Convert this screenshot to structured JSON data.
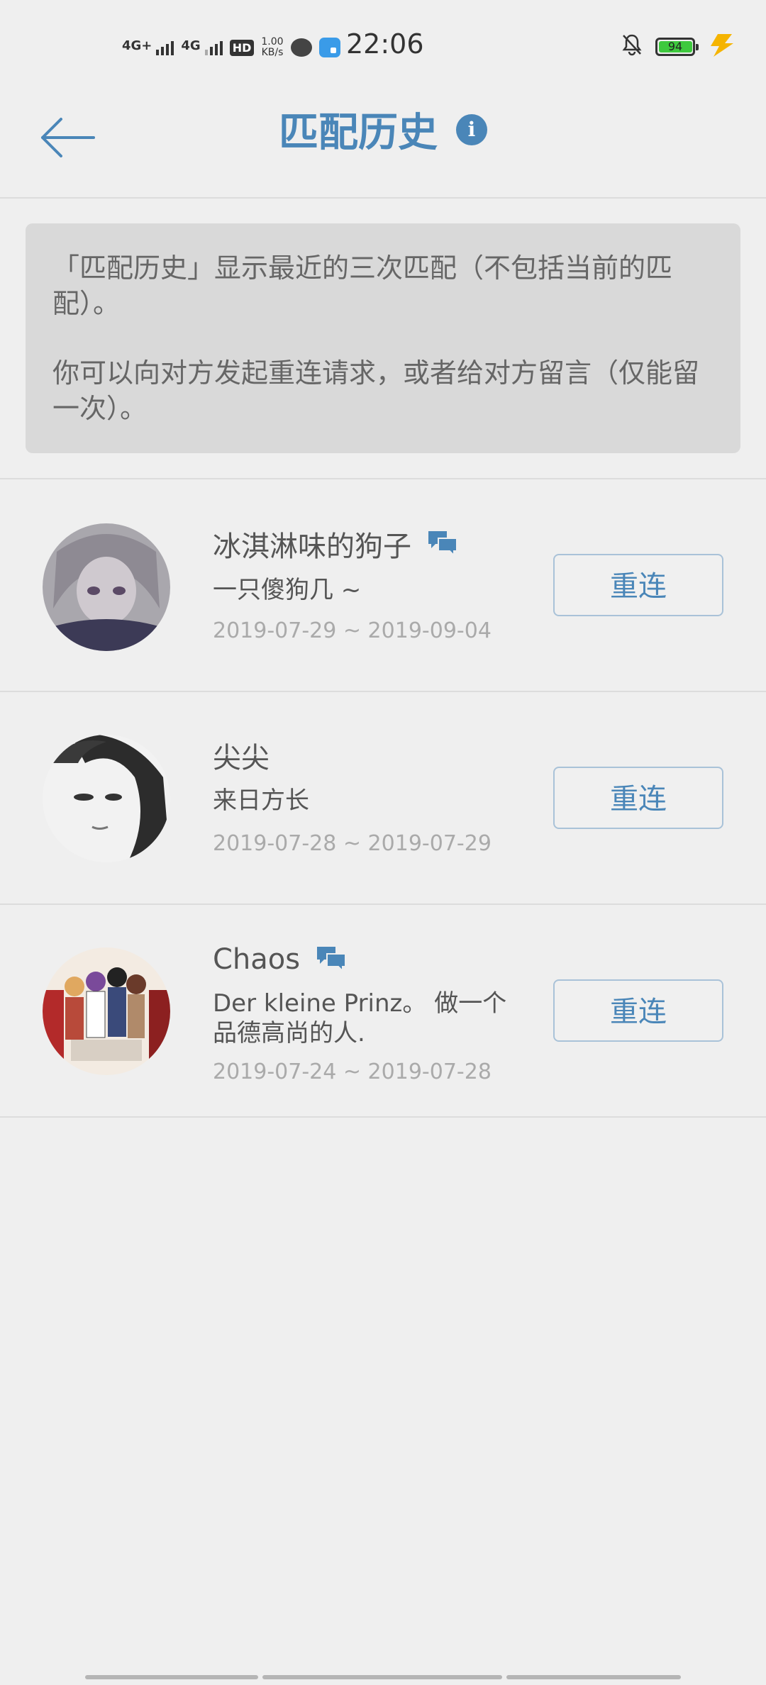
{
  "status_bar": {
    "sim1": "4G+",
    "sim2": "4G",
    "hd": "HD",
    "speed_value": "1.00",
    "speed_unit": "KB/s",
    "time": "22:06",
    "battery": "94"
  },
  "header": {
    "title": "匹配历史",
    "info_icon": "i"
  },
  "notice": {
    "line1": "「匹配历史」显示最近的三次匹配（不包括当前的匹配）。",
    "line2": "你可以向对方发起重连请求，或者给对方留言（仅能留一次）。"
  },
  "matches": [
    {
      "name": "冰淇淋味的狗子",
      "has_message_icon": true,
      "signature": "一只傻狗几 ~",
      "dates": "2019-07-29 ~ 2019-09-04",
      "button": "重连"
    },
    {
      "name": "尖尖",
      "has_message_icon": false,
      "signature": "来日方长",
      "dates": "2019-07-28 ~ 2019-07-29",
      "button": "重连"
    },
    {
      "name": "Chaos",
      "has_message_icon": true,
      "signature": "Der kleine Prinz。 做一个品德高尚的人.",
      "dates": "2019-07-24 ~ 2019-07-28",
      "button": "重连"
    }
  ],
  "colors": {
    "accent": "#4a86b8",
    "background": "#efefef",
    "notice_bg": "#d9d9d9",
    "battery": "#3ec93e"
  }
}
